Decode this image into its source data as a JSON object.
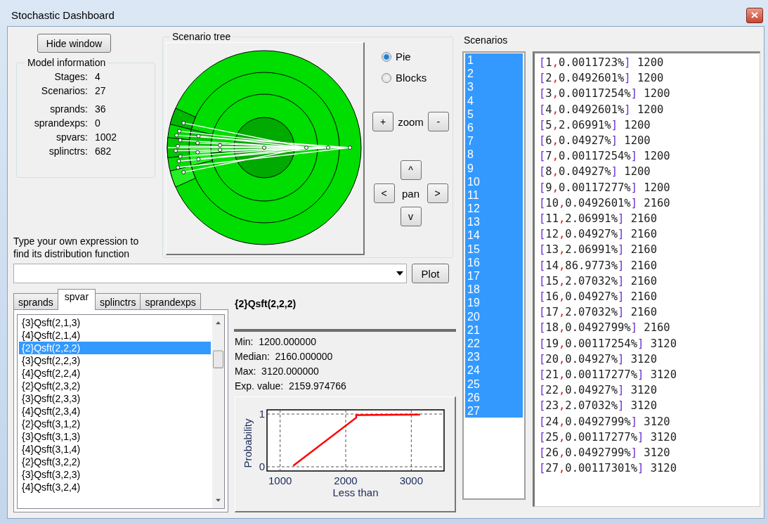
{
  "window": {
    "title": "Stochastic Dashboard"
  },
  "hide_button": "Hide window",
  "model_information": {
    "title": "Model information",
    "groups": [
      [
        {
          "label": "Stages:",
          "value": "4"
        },
        {
          "label": "Scenarios:",
          "value": "27"
        }
      ],
      [
        {
          "label": "sprands:",
          "value": "36"
        },
        {
          "label": "sprandexps:",
          "value": "0"
        },
        {
          "label": "spvars:",
          "value": "1002"
        },
        {
          "label": "splinctrs:",
          "value": "682"
        }
      ]
    ]
  },
  "scenario_tree": {
    "title": "Scenario tree",
    "views": [
      {
        "label": "Pie",
        "selected": true
      },
      {
        "label": "Blocks",
        "selected": false
      }
    ],
    "zoom": {
      "in": "+",
      "label": "zoom",
      "out": "-"
    },
    "pan": {
      "up": "^",
      "left": "<",
      "label": "pan",
      "right": ">",
      "down": "v"
    }
  },
  "expression": {
    "prompt": "Type your own expression to find its distribution function",
    "plot_button": "Plot"
  },
  "tabs": [
    {
      "label": "sprands",
      "selected": false
    },
    {
      "label": "spvar",
      "selected": true
    },
    {
      "label": "splinctrs",
      "selected": false
    },
    {
      "label": "sprandexps",
      "selected": false
    }
  ],
  "variables": [
    {
      "label": "{3}Qsft(2,1,3)",
      "selected": false
    },
    {
      "label": "{4}Qsft(2,1,4)",
      "selected": false
    },
    {
      "label": "{2}Qsft(2,2,2)",
      "selected": true
    },
    {
      "label": "{3}Qsft(2,2,3)",
      "selected": false
    },
    {
      "label": "{4}Qsft(2,2,4)",
      "selected": false
    },
    {
      "label": "{2}Qsft(2,3,2)",
      "selected": false
    },
    {
      "label": "{3}Qsft(2,3,3)",
      "selected": false
    },
    {
      "label": "{4}Qsft(2,3,4)",
      "selected": false
    },
    {
      "label": "{2}Qsft(3,1,2)",
      "selected": false
    },
    {
      "label": "{3}Qsft(3,1,3)",
      "selected": false
    },
    {
      "label": "{4}Qsft(3,1,4)",
      "selected": false
    },
    {
      "label": "{2}Qsft(3,2,2)",
      "selected": false
    },
    {
      "label": "{3}Qsft(3,2,3)",
      "selected": false
    },
    {
      "label": "{4}Qsft(3,2,4)",
      "selected": false
    }
  ],
  "detail": {
    "title": "{2}Qsft(2,2,2)",
    "stats": [
      {
        "label": "Min:",
        "value": "1200.000000"
      },
      {
        "label": "Median:",
        "value": "2160.000000"
      },
      {
        "label": "Max:",
        "value": "3120.000000"
      },
      {
        "label": "Exp. value:",
        "value": "2159.974766"
      }
    ],
    "chart_data": {
      "type": "line",
      "xlabel": "Less than",
      "ylabel": "Probability",
      "x": [
        1200,
        2160,
        2160,
        3120,
        3120
      ],
      "grid": true,
      "series": [
        {
          "color": "#ff0000",
          "values": [
            0.02,
            0.93,
            0.98,
            0.99,
            1.0
          ]
        }
      ],
      "xlim": [
        800,
        3500
      ],
      "ylim": [
        -0.08,
        1.08
      ],
      "xticks": [
        1000,
        2000,
        3000
      ],
      "yticks": [
        0,
        1
      ]
    }
  },
  "scenarios": {
    "title": "Scenarios",
    "numbers": [
      {
        "label": "1",
        "selected": true
      },
      {
        "label": "2",
        "selected": true
      },
      {
        "label": "3",
        "selected": true
      },
      {
        "label": "4",
        "selected": true
      },
      {
        "label": "5",
        "selected": true
      },
      {
        "label": "6",
        "selected": true
      },
      {
        "label": "7",
        "selected": true
      },
      {
        "label": "8",
        "selected": true
      },
      {
        "label": "9",
        "selected": true
      },
      {
        "label": "10",
        "selected": true
      },
      {
        "label": "11",
        "selected": true
      },
      {
        "label": "12",
        "selected": true
      },
      {
        "label": "13",
        "selected": true
      },
      {
        "label": "14",
        "selected": true
      },
      {
        "label": "15",
        "selected": true
      },
      {
        "label": "16",
        "selected": true
      },
      {
        "label": "17",
        "selected": true
      },
      {
        "label": "18",
        "selected": true
      },
      {
        "label": "19",
        "selected": true
      },
      {
        "label": "20",
        "selected": true
      },
      {
        "label": "21",
        "selected": true
      },
      {
        "label": "22",
        "selected": true
      },
      {
        "label": "23",
        "selected": true
      },
      {
        "label": "24",
        "selected": true
      },
      {
        "label": "25",
        "selected": true
      },
      {
        "label": "26",
        "selected": true
      },
      {
        "label": "27",
        "selected": true
      }
    ],
    "entries": [
      "[1,0.0011723%] 1200",
      "[2,0.0492601%] 1200",
      "[3,0.00117254%] 1200",
      "[4,0.0492601%] 1200",
      "[5,2.06991%] 1200",
      "[6,0.04927%] 1200",
      "[7,0.00117254%] 1200",
      "[8,0.04927%] 1200",
      "[9,0.00117277%] 1200",
      "[10,0.0492601%] 2160",
      "[11,2.06991%] 2160",
      "[12,0.04927%] 2160",
      "[13,2.06991%] 2160",
      "[14,86.9773%] 2160",
      "[15,2.07032%] 2160",
      "[16,0.04927%] 2160",
      "[17,2.07032%] 2160",
      "[18,0.0492799%] 2160",
      "[19,0.00117254%] 3120",
      "[20,0.04927%] 3120",
      "[21,0.00117277%] 3120",
      "[22,0.04927%] 3120",
      "[23,2.07032%] 3120",
      "[24,0.0492799%] 3120",
      "[25,0.00117277%] 3120",
      "[26,0.0492799%] 3120",
      "[27,0.00117301%] 3120"
    ]
  }
}
